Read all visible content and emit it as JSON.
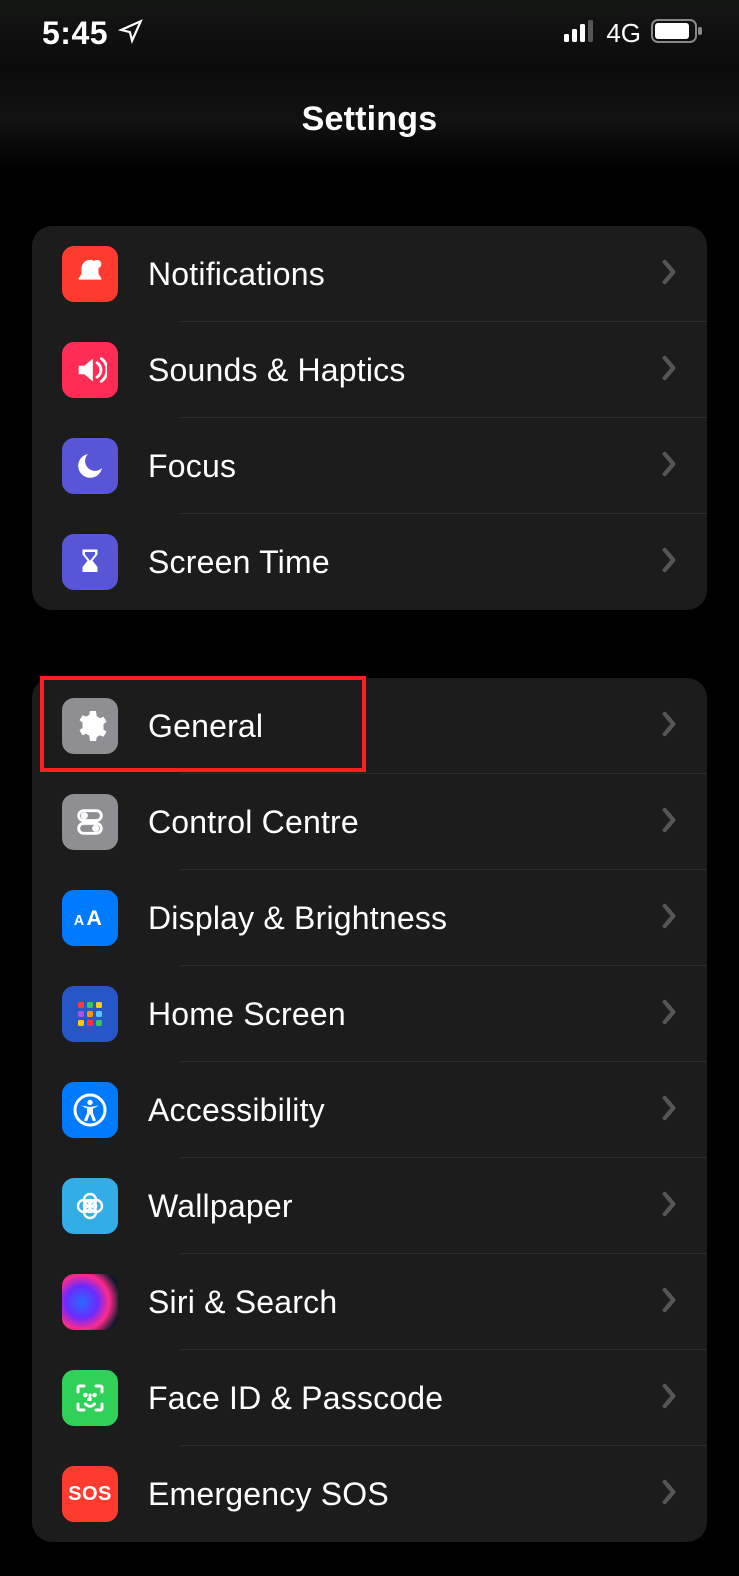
{
  "statusbar": {
    "time": "5:45",
    "network_label": "4G"
  },
  "header": {
    "title": "Settings"
  },
  "group1": {
    "notifications": "Notifications",
    "sounds": "Sounds & Haptics",
    "focus": "Focus",
    "screentime": "Screen Time"
  },
  "group2": {
    "general": "General",
    "controlcentre": "Control Centre",
    "display": "Display & Brightness",
    "homescreen": "Home Screen",
    "accessibility": "Accessibility",
    "wallpaper": "Wallpaper",
    "siri": "Siri & Search",
    "faceid": "Face ID & Passcode",
    "sos": "Emergency SOS"
  },
  "highlight": {
    "target": "general"
  }
}
